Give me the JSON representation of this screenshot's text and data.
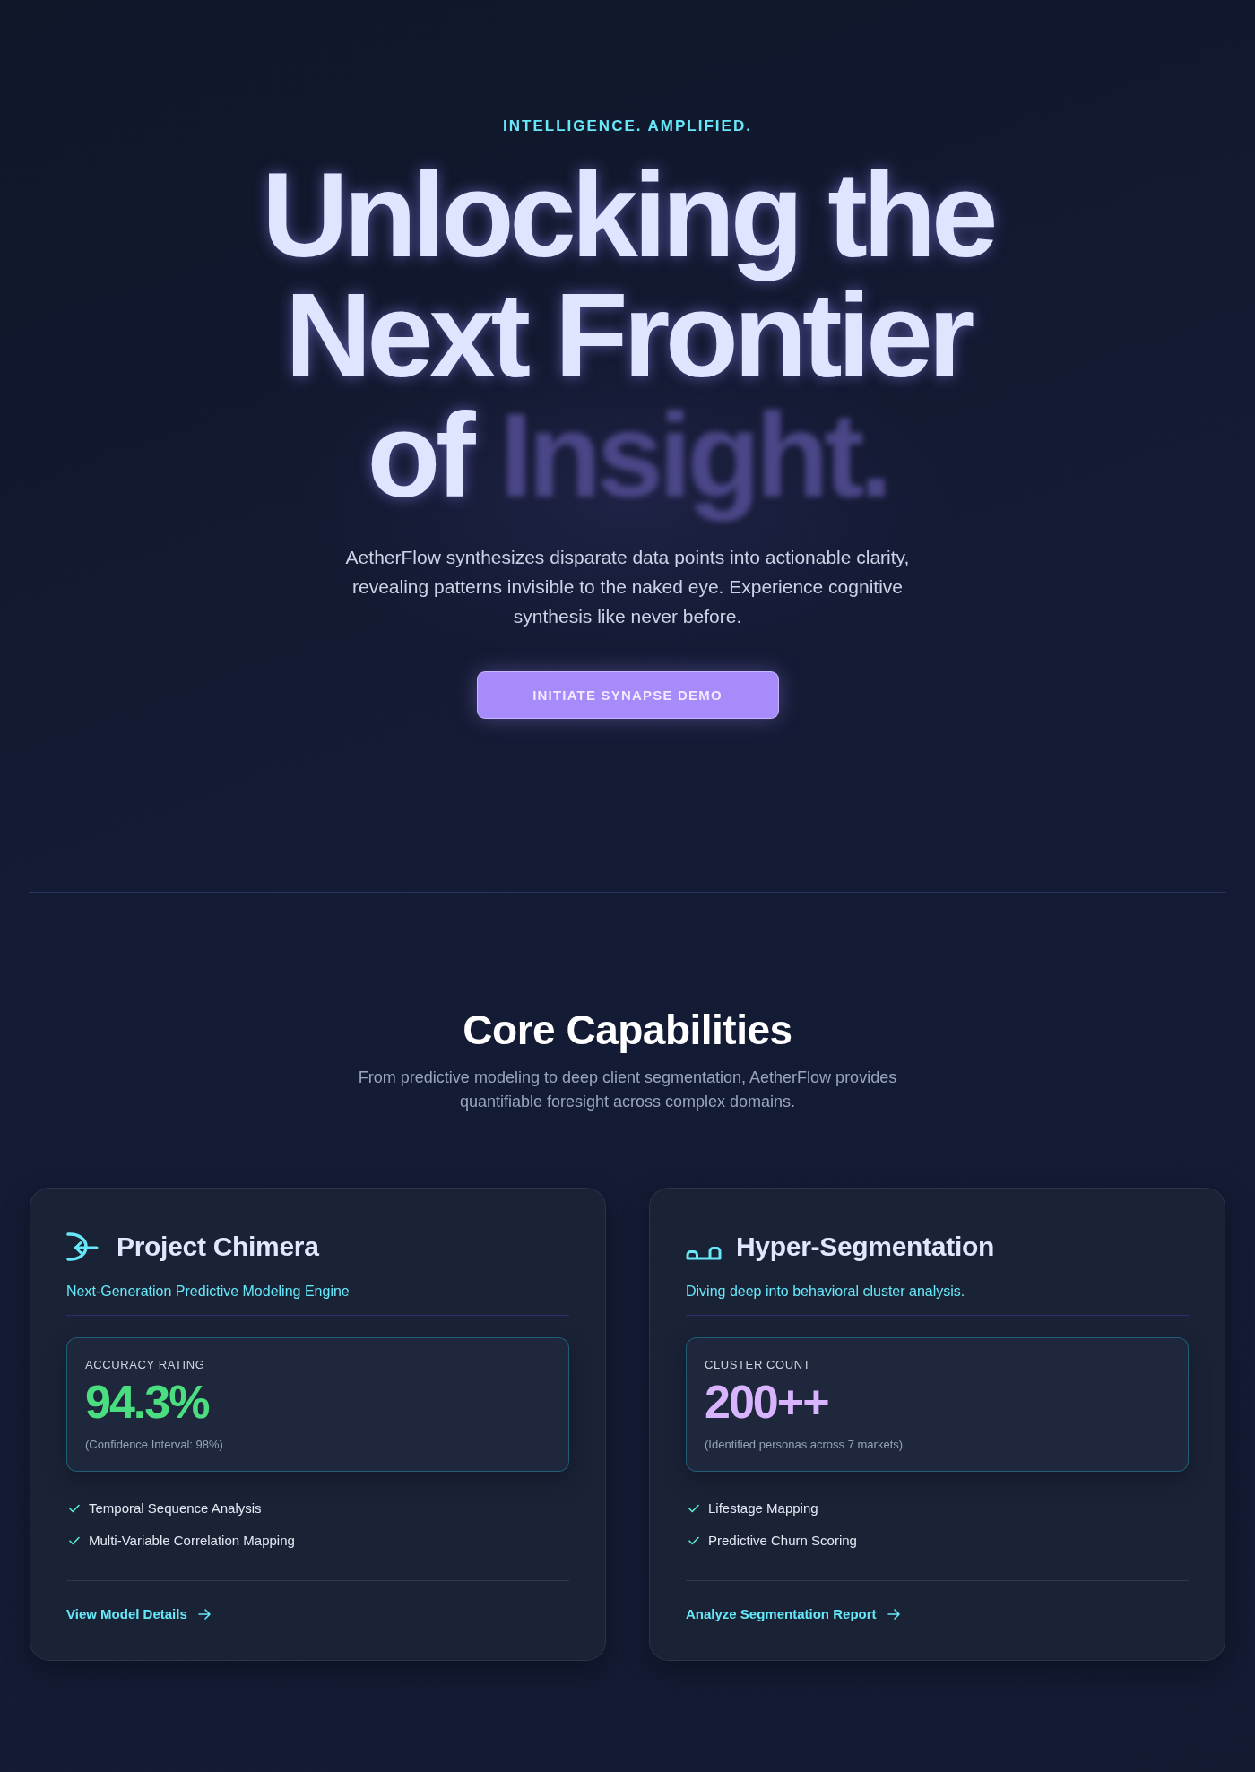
{
  "hero": {
    "eyebrow": "INTELLIGENCE. AMPLIFIED.",
    "headline": "Unlocking the Next Frontier of",
    "headline_highlight": "Insight.",
    "description": "AetherFlow synthesizes disparate data points into actionable clarity, revealing patterns invisible to the naked eye. Experience cognitive synthesis like never before.",
    "cta": "INITIATE SYNAPSE DEMO"
  },
  "capabilities": {
    "title": "Core Capabilities",
    "description": "From predictive modeling to deep client segmentation, AetherFlow provides quantifiable foresight across complex domains.",
    "cards": [
      {
        "title": "Project Chimera",
        "subtitle": "Next-Generation Predictive Modeling Engine",
        "metric": {
          "label": "ACCURACY RATING",
          "value": "94.3%",
          "color": "#4ade80",
          "note": "(Confidence Interval: 98%)"
        },
        "features": [
          "Temporal Sequence Analysis",
          "Multi-Variable Correlation Mapping"
        ],
        "link": "View Model Details"
      },
      {
        "title": "Hyper-Segmentation",
        "subtitle": "Diving deep into behavioral cluster analysis.",
        "metric": {
          "label": "CLUSTER COUNT",
          "value": "200++",
          "color": "#d8b4fe",
          "note": "(Identified personas across 7 markets)"
        },
        "features": [
          "Lifestage Mapping",
          "Predictive Churn Scoring"
        ],
        "link": "Analyze Segmentation Report"
      }
    ]
  }
}
